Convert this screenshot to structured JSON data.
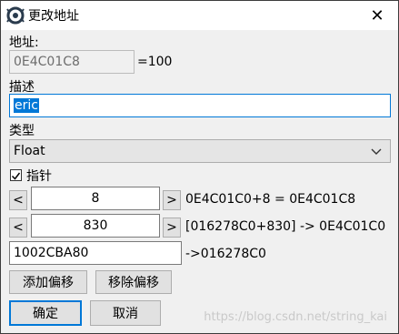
{
  "window": {
    "title": "更改地址",
    "close_glyph": "✕"
  },
  "address": {
    "label": "地址:",
    "value": "0E4C01C8",
    "result": "=100"
  },
  "description": {
    "label": "描述",
    "value": "eric"
  },
  "type": {
    "label": "类型",
    "selected": "Float"
  },
  "pointer": {
    "label": "指针",
    "checked": true
  },
  "offsets": [
    {
      "dec_label": "<",
      "value": "8",
      "inc_label": ">",
      "result": "0E4C01C0+8 = 0E4C01C8"
    },
    {
      "dec_label": "<",
      "value": "830",
      "inc_label": ">",
      "result": "[016278C0+830] -> 0E4C01C0"
    }
  ],
  "base": {
    "value": "1002CBA80",
    "result": "->016278C0"
  },
  "buttons": {
    "add_offset": "添加偏移",
    "remove_offset": "移除偏移",
    "ok": "确定",
    "cancel": "取消"
  },
  "watermark": "https://blog.csdn.net/string_kai"
}
